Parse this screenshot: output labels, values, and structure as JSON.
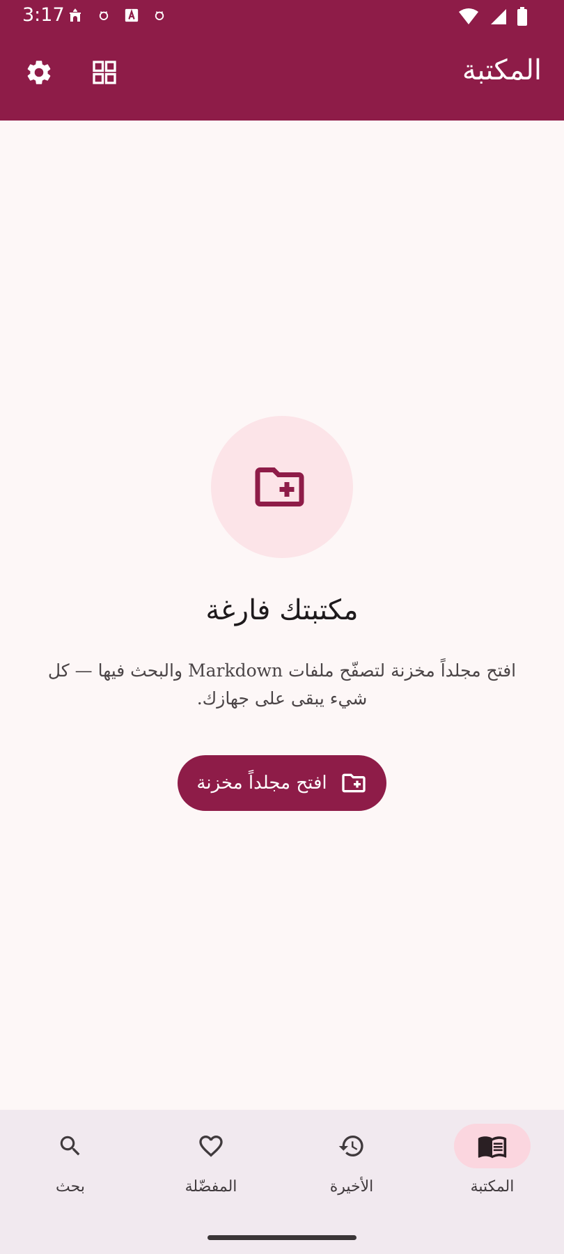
{
  "status_bar": {
    "time": "3:17",
    "icons": [
      "mosque-icon",
      "notification-icon",
      "a-icon",
      "notification-icon",
      "wifi-icon",
      "signal-icon",
      "battery-icon"
    ]
  },
  "app_bar": {
    "title": "المكتبة",
    "actions": [
      "settings-icon",
      "grid-view-icon"
    ]
  },
  "empty_state": {
    "icon": "folder-add-icon",
    "title": "مكتبتك فارغة",
    "description": "افتح مجلداً مخزنة لتصفّح ملفات Markdown والبحث فيها — كل شيء يبقى على جهازك.",
    "button_label": "افتح مجلداً مخزنة"
  },
  "bottom_nav": {
    "items": [
      {
        "label": "بحث",
        "icon": "search-icon"
      },
      {
        "label": "المفضّلة",
        "icon": "heart-icon"
      },
      {
        "label": "الأخيرة",
        "icon": "history-icon"
      },
      {
        "label": "المكتبة",
        "icon": "book-icon",
        "active": true
      }
    ]
  },
  "colors": {
    "primary": "#8e1c48",
    "background": "#fdf7f7",
    "accent_tint": "#fce4e8",
    "nav_background": "#f1e9ef",
    "nav_active_pill": "#fbd6df"
  }
}
